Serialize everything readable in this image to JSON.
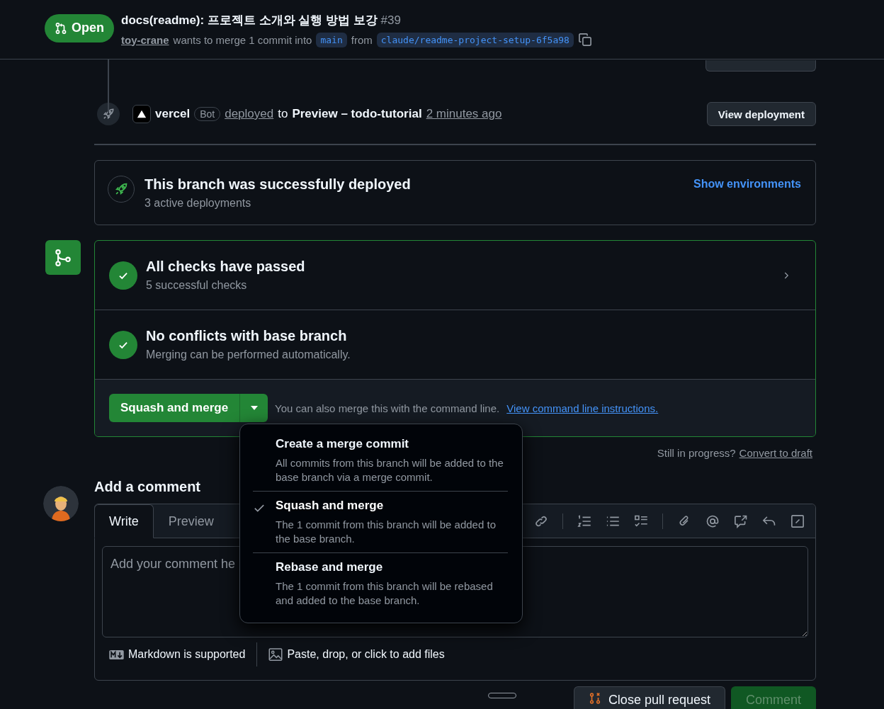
{
  "header": {
    "state": "Open",
    "title": "docs(readme): 프로젝트 소개와 실행 방법 보강",
    "number": "#39",
    "author": "toy-crane",
    "summary": "wants to merge 1 commit into",
    "base_branch": "main",
    "from_word": "from",
    "head_branch": "claude/readme-project-setup-6f5a98"
  },
  "deployment_event": {
    "actor": "vercel",
    "badge": "Bot",
    "action": "deployed",
    "to_word": "to",
    "environment": "Preview – todo-tutorial",
    "time": "2 minutes ago",
    "button": "View deployment"
  },
  "deployments_box": {
    "title": "This branch was successfully deployed",
    "subtitle": "3 active deployments",
    "link": "Show environments"
  },
  "checks": [
    {
      "title": "All checks have passed",
      "subtitle": "5 successful checks",
      "expandable": true
    },
    {
      "title": "No conflicts with base branch",
      "subtitle": "Merging can be performed automatically.",
      "expandable": false
    }
  ],
  "merge": {
    "button": "Squash and merge",
    "note": "You can also merge this with the command line.",
    "link": "View command line instructions."
  },
  "merge_menu": [
    {
      "title": "Create a merge commit",
      "description": "All commits from this branch will be added to the base branch via a merge commit.",
      "selected": false
    },
    {
      "title": "Squash and merge",
      "description": "The 1 commit from this branch will be added to the base branch.",
      "selected": true
    },
    {
      "title": "Rebase and merge",
      "description": "The 1 commit from this branch will be rebased and added to the base branch.",
      "selected": false
    }
  ],
  "draft": {
    "prompt": "Still in progress?",
    "link": "Convert to draft"
  },
  "comment": {
    "heading": "Add a comment",
    "tabs": [
      {
        "label": "Write",
        "selected": true
      },
      {
        "label": "Preview",
        "selected": false
      }
    ],
    "placeholder": "Add your comment he",
    "markdown_note": "Markdown is supported",
    "attach_note": "Paste, drop, or click to add files"
  },
  "actions": [
    {
      "label": "Close pull request",
      "kind": "close",
      "disabled": false
    },
    {
      "label": "Comment",
      "kind": "comment",
      "disabled": true
    }
  ]
}
